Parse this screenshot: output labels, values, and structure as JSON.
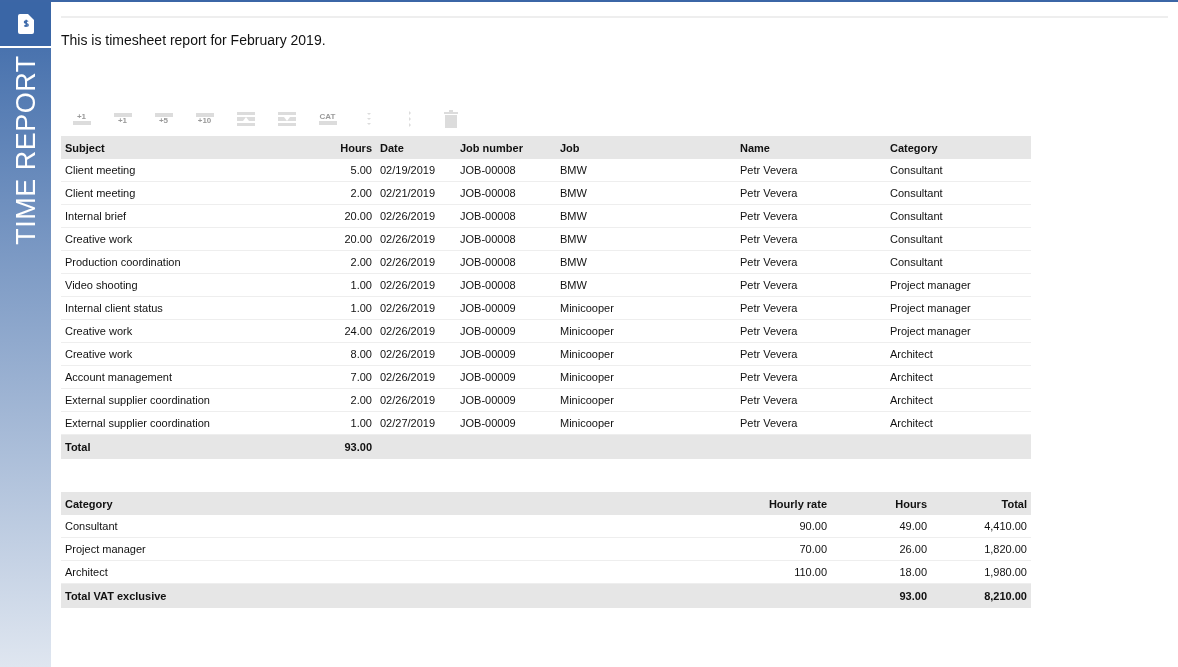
{
  "sidebar": {
    "label": "TIME REPORT"
  },
  "intro": "This is timesheet report for February 2019.",
  "toolbar": [
    {
      "kind": "above",
      "label": "+1",
      "disabled": true
    },
    {
      "kind": "below",
      "label": "+1",
      "disabled": true
    },
    {
      "kind": "below",
      "label": "+5",
      "disabled": true
    },
    {
      "kind": "below",
      "label": "+10",
      "disabled": true
    },
    {
      "kind": "row-up",
      "disabled": true
    },
    {
      "kind": "row-down",
      "disabled": true
    },
    {
      "kind": "above",
      "label": "CAT",
      "disabled": true
    },
    {
      "kind": "dots-down",
      "disabled": true
    },
    {
      "kind": "dots-right",
      "disabled": true
    },
    {
      "kind": "trash",
      "disabled": true
    }
  ],
  "entries": {
    "columns": [
      "Subject",
      "Hours",
      "Date",
      "Job number",
      "Job",
      "Name",
      "Category"
    ],
    "rows": [
      [
        "Client meeting",
        "5.00",
        "02/19/2019",
        "JOB-00008",
        "BMW",
        "Petr Vevera",
        "Consultant"
      ],
      [
        "Client meeting",
        "2.00",
        "02/21/2019",
        "JOB-00008",
        "BMW",
        "Petr Vevera",
        "Consultant"
      ],
      [
        "Internal brief",
        "20.00",
        "02/26/2019",
        "JOB-00008",
        "BMW",
        "Petr Vevera",
        "Consultant"
      ],
      [
        "Creative work",
        "20.00",
        "02/26/2019",
        "JOB-00008",
        "BMW",
        "Petr Vevera",
        "Consultant"
      ],
      [
        "Production coordination",
        "2.00",
        "02/26/2019",
        "JOB-00008",
        "BMW",
        "Petr Vevera",
        "Consultant"
      ],
      [
        "Video shooting",
        "1.00",
        "02/26/2019",
        "JOB-00008",
        "BMW",
        "Petr Vevera",
        "Project manager"
      ],
      [
        "Internal client status",
        "1.00",
        "02/26/2019",
        "JOB-00009",
        "Minicooper",
        "Petr Vevera",
        "Project manager"
      ],
      [
        "Creative work",
        "24.00",
        "02/26/2019",
        "JOB-00009",
        "Minicooper",
        "Petr Vevera",
        "Project manager"
      ],
      [
        "Creative work",
        "8.00",
        "02/26/2019",
        "JOB-00009",
        "Minicooper",
        "Petr Vevera",
        "Architect"
      ],
      [
        "Account management",
        "7.00",
        "02/26/2019",
        "JOB-00009",
        "Minicooper",
        "Petr Vevera",
        "Architect"
      ],
      [
        "External supplier coordination",
        "2.00",
        "02/26/2019",
        "JOB-00009",
        "Minicooper",
        "Petr Vevera",
        "Architect"
      ],
      [
        "External supplier coordination",
        "1.00",
        "02/27/2019",
        "JOB-00009",
        "Minicooper",
        "Petr Vevera",
        "Architect"
      ]
    ],
    "total": {
      "label": "Total",
      "hours": "93.00"
    }
  },
  "summary": {
    "columns": [
      "Category",
      "Hourly rate",
      "Hours",
      "Total"
    ],
    "rows": [
      [
        "Consultant",
        "90.00",
        "49.00",
        "4,410.00"
      ],
      [
        "Project manager",
        "70.00",
        "26.00",
        "1,820.00"
      ],
      [
        "Architect",
        "110.00",
        "18.00",
        "1,980.00"
      ]
    ],
    "total": {
      "label": "Total VAT exclusive",
      "hours": "93.00",
      "total": "8,210.00"
    }
  }
}
